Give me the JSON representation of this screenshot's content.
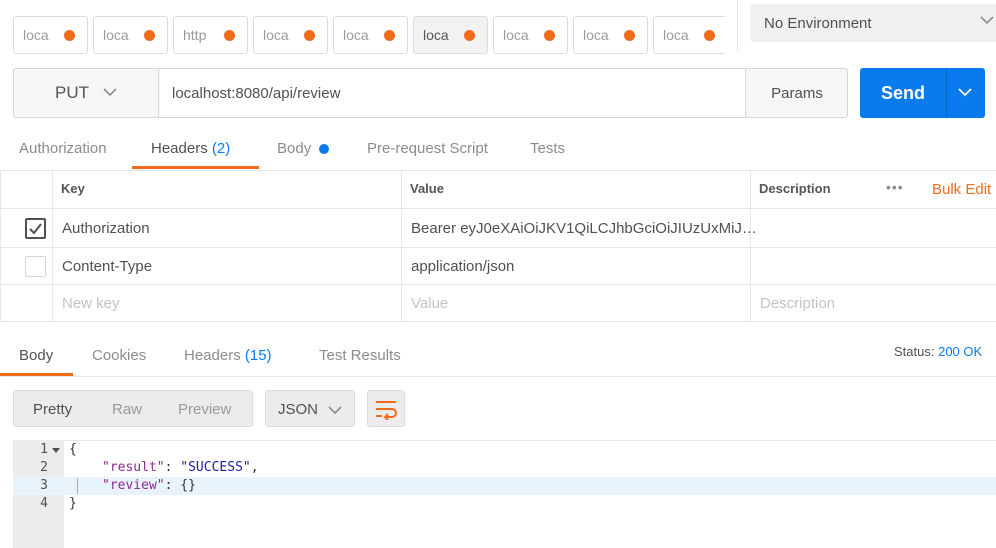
{
  "tabs": [
    {
      "label": "loca",
      "active": false
    },
    {
      "label": "loca",
      "active": false
    },
    {
      "label": "http",
      "active": false
    },
    {
      "label": "loca",
      "active": false
    },
    {
      "label": "loca",
      "active": false
    },
    {
      "label": "loca",
      "active": true
    },
    {
      "label": "loca",
      "active": false
    },
    {
      "label": "loca",
      "active": false
    },
    {
      "label": "loca",
      "active": false
    }
  ],
  "environment": {
    "selected": "No Environment"
  },
  "request": {
    "method": "PUT",
    "url": "localhost:8080/api/review",
    "params_label": "Params",
    "send_label": "Send"
  },
  "request_tabs": {
    "authorization": "Authorization",
    "headers": "Headers",
    "headers_count": "(2)",
    "body": "Body",
    "prerequest": "Pre-request Script",
    "tests": "Tests"
  },
  "headers_table": {
    "col_key": "Key",
    "col_value": "Value",
    "col_description": "Description",
    "more": "•••",
    "bulk_edit": "Bulk Edit",
    "rows": [
      {
        "checked": true,
        "key": "Authorization",
        "value": "Bearer eyJ0eXAiOiJKV1QiLCJhbGciOiJIUzUxMiJ…",
        "description": ""
      },
      {
        "checked": false,
        "key": "Content-Type",
        "value": "application/json",
        "description": ""
      }
    ],
    "placeholder": {
      "key": "New key",
      "value": "Value",
      "description": "Description"
    }
  },
  "response_tabs": {
    "body": "Body",
    "cookies": "Cookies",
    "headers": "Headers",
    "headers_count": "(15)",
    "test_results": "Test Results"
  },
  "status": {
    "label": "Status:",
    "value": "200 OK"
  },
  "view": {
    "pretty": "Pretty",
    "raw": "Raw",
    "preview": "Preview",
    "format": "JSON"
  },
  "code": {
    "line_numbers": [
      "1",
      "2",
      "3",
      "4"
    ],
    "line1": "{",
    "line2_key": "\"result\"",
    "line2_sep": ": ",
    "line2_val": "\"SUCCESS\"",
    "line2_end": ",",
    "line3_key": "\"review\"",
    "line3_rest": ": {}",
    "line4": "}"
  },
  "colors": {
    "accent_orange": "#f26b1d",
    "accent_blue": "#097bed"
  }
}
